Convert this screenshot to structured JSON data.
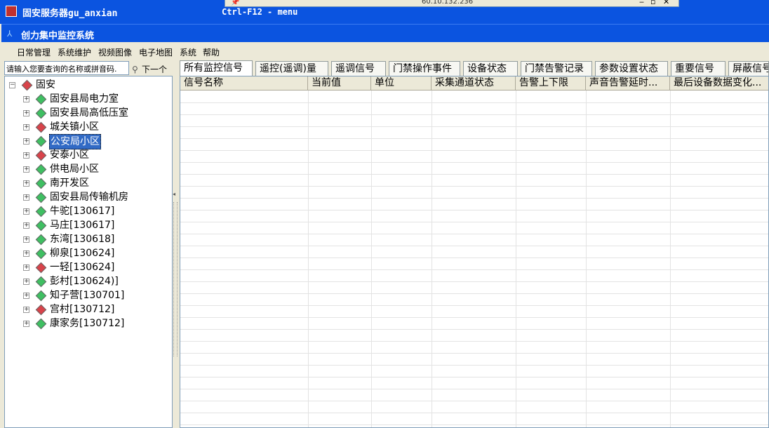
{
  "window": {
    "title": "固安服务器gu_anxian",
    "hint": "Ctrl-F12 - menu"
  },
  "remote": {
    "ip": "60.10.132.236",
    "min": "‒",
    "restore": "▫",
    "close": "✕"
  },
  "app": {
    "title": "创力集中监控系统"
  },
  "menu": [
    "日常管理",
    "系统维护",
    "视频图像",
    "电子地图",
    "系统",
    "帮助"
  ],
  "search": {
    "placeholder": "请输入您要查询的名称或拼音码.",
    "next_label": "下一个"
  },
  "tree": {
    "root": "固安",
    "selected": "公安局小区",
    "items": [
      {
        "label": "固安县局电力室",
        "status": "green"
      },
      {
        "label": "固安县局高低压室",
        "status": "green"
      },
      {
        "label": "城关镇小区",
        "status": "red"
      },
      {
        "label": "公安局小区",
        "status": "green"
      },
      {
        "label": "安泰小区",
        "status": "red"
      },
      {
        "label": "供电局小区",
        "status": "green"
      },
      {
        "label": "南开发区",
        "status": "green"
      },
      {
        "label": "固安县局传输机房",
        "status": "green"
      },
      {
        "label": "牛驼[130617]",
        "status": "green"
      },
      {
        "label": "马庄[130617]",
        "status": "green"
      },
      {
        "label": "东湾[130618]",
        "status": "green"
      },
      {
        "label": "柳泉[130624]",
        "status": "green"
      },
      {
        "label": "一轻[130624]",
        "status": "red"
      },
      {
        "label": "彭村[130624)]",
        "status": "green"
      },
      {
        "label": "知子营[130701]",
        "status": "green"
      },
      {
        "label": "宫村[130712]",
        "status": "red"
      },
      {
        "label": "康家务[130712]",
        "status": "green"
      }
    ]
  },
  "tabs": [
    "所有监控信号",
    "遥控(遥调)量",
    "遥调信号",
    "门禁操作事件",
    "设备状态",
    "门禁告警记录",
    "参数设置状态",
    "重要信号",
    "屏蔽信号"
  ],
  "table": {
    "columns": [
      "信号名称",
      "当前值",
      "单位",
      "采集通道状态",
      "告警上下限",
      "声音告警延时...",
      "最后设备数据变化..."
    ],
    "rows": []
  },
  "colors": {
    "titlebar": "#0b54e0",
    "status_green": "#3fbf62",
    "status_red": "#d8434a",
    "selection": "#316ac5"
  }
}
